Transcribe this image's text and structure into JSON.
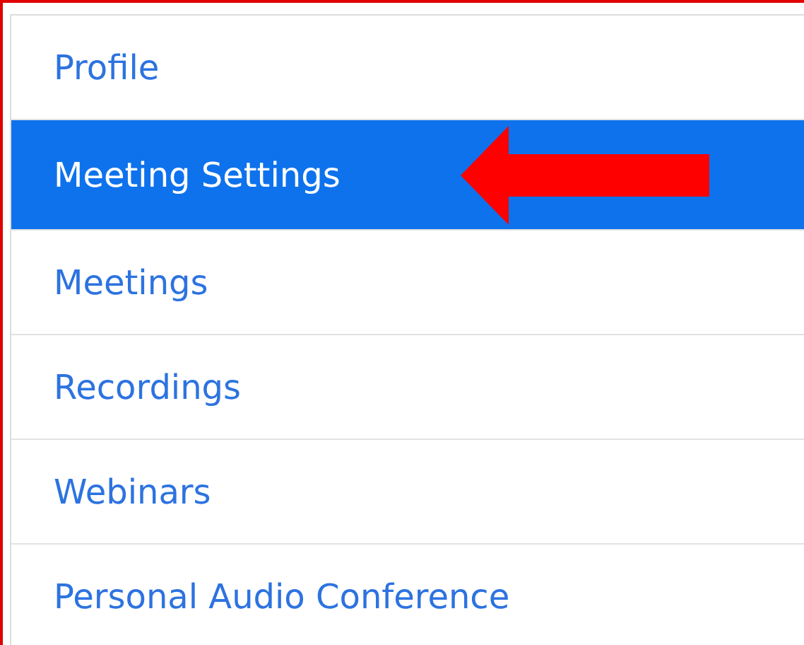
{
  "menu": {
    "items": [
      {
        "label": "Profile",
        "selected": false
      },
      {
        "label": "Meeting Settings",
        "selected": true
      },
      {
        "label": "Meetings",
        "selected": false
      },
      {
        "label": "Recordings",
        "selected": false
      },
      {
        "label": "Webinars",
        "selected": false
      },
      {
        "label": "Personal Audio Conference",
        "selected": false
      }
    ]
  }
}
